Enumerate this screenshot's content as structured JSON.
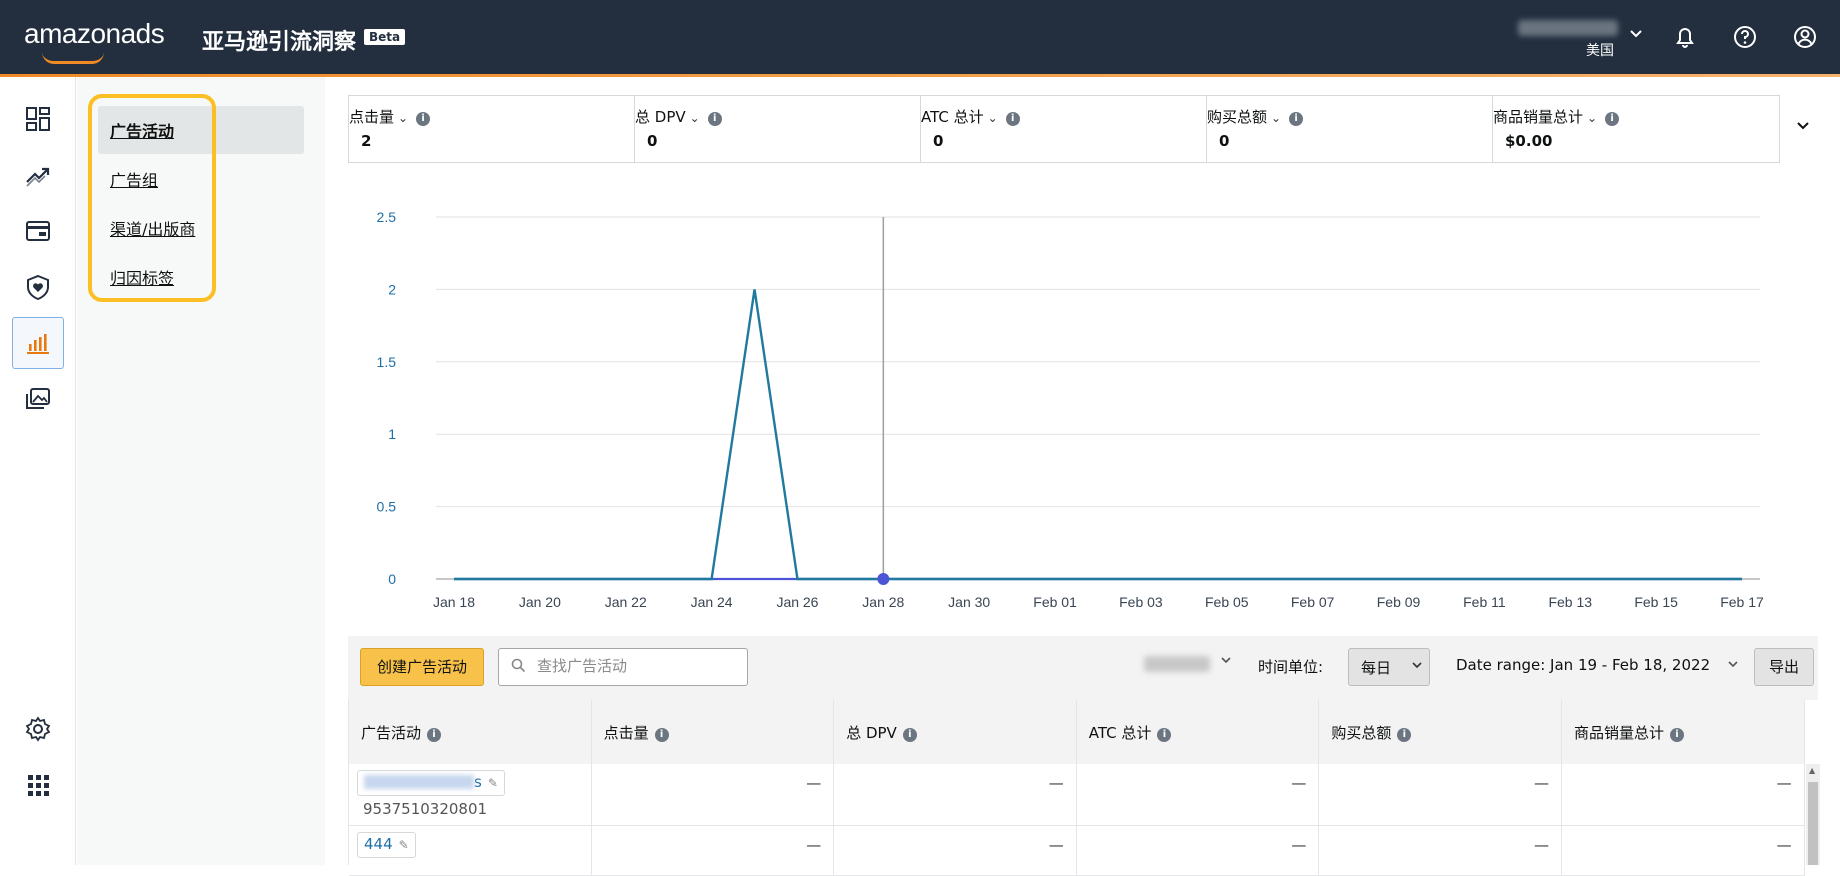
{
  "header": {
    "logo_text": "amazonads",
    "app_title": "亚马逊引流洞察",
    "beta_label": "Beta",
    "region": "美国",
    "icons": [
      "bell-icon",
      "help-icon",
      "account-icon"
    ]
  },
  "rail": {
    "items": [
      "dashboard-icon",
      "trend-icon",
      "wallet-icon",
      "shield-heart-icon",
      "bar-chart-icon",
      "media-icon"
    ],
    "bottom": [
      "settings-icon",
      "apps-grid-icon"
    ]
  },
  "subnav": {
    "items": [
      "广告活动",
      "广告组",
      "渠道/出版商",
      "归因标签"
    ]
  },
  "metrics": [
    {
      "label": "点击量",
      "value": "2"
    },
    {
      "label": "总 DPV",
      "value": "0"
    },
    {
      "label": "ATC 总计",
      "value": "0"
    },
    {
      "label": "购买总额",
      "value": "0"
    },
    {
      "label": "商品销量总计",
      "value": "$0.00"
    }
  ],
  "chart_data": {
    "type": "line",
    "x_ticks": [
      "Jan 18",
      "Jan 20",
      "Jan 22",
      "Jan 24",
      "Jan 26",
      "Jan 28",
      "Jan 30",
      "Feb 01",
      "Feb 03",
      "Feb 05",
      "Feb 07",
      "Feb 09",
      "Feb 11",
      "Feb 13",
      "Feb 15",
      "Feb 17"
    ],
    "y_ticks": [
      "2.5",
      "2",
      "1.5",
      "1",
      "0.5",
      "0"
    ],
    "ylim": [
      0,
      2.5
    ],
    "grid": true,
    "colors": {
      "primary": "#1f7a9e",
      "secondary": "#4b55d6"
    },
    "series": [
      {
        "values": [
          0,
          0,
          0,
          0,
          0,
          0,
          0,
          2,
          0,
          0,
          0,
          0,
          0,
          0,
          0,
          0,
          0,
          0,
          0,
          0,
          0,
          0,
          0,
          0,
          0,
          0,
          0,
          0,
          0,
          0,
          0
        ]
      },
      {
        "values": [
          0,
          0,
          0,
          0,
          0,
          0,
          0,
          0,
          0,
          0,
          0,
          0,
          0,
          0,
          0,
          0,
          0,
          0,
          0,
          0,
          0,
          0,
          0,
          0,
          0,
          0,
          0,
          0,
          0,
          0,
          0
        ]
      }
    ],
    "x_dates": [
      "Jan 18",
      "Jan 19",
      "Jan 20",
      "Jan 21",
      "Jan 22",
      "Jan 23",
      "Jan 24",
      "Jan 25",
      "Jan 26",
      "Jan 27",
      "Jan 28",
      "Jan 29",
      "Jan 30",
      "Jan 31",
      "Feb 01",
      "Feb 02",
      "Feb 03",
      "Feb 04",
      "Feb 05",
      "Feb 06",
      "Feb 07",
      "Feb 08",
      "Feb 09",
      "Feb 10",
      "Feb 11",
      "Feb 12",
      "Feb 13",
      "Feb 14",
      "Feb 15",
      "Feb 16",
      "Feb 17"
    ],
    "hover_date": "Jan 28"
  },
  "toolbar": {
    "create_label": "创建广告活动",
    "search_placeholder": "查找广告活动",
    "time_unit_label": "时间单位:",
    "time_unit_value": "每日",
    "date_range": "Date range: Jan 19 - Feb 18, 2022",
    "export_label": "导出"
  },
  "table": {
    "headers": [
      "广告活动",
      "点击量",
      "总 DPV",
      "ATC 总计",
      "购买总额",
      "商品销量总计"
    ],
    "rows": [
      {
        "name_suffix": "s",
        "id": "9537510320801",
        "cells": [
          "—",
          "—",
          "—",
          "—",
          "—"
        ]
      },
      {
        "name": "444",
        "cells": [
          "—",
          "—",
          "—",
          "—",
          "—"
        ]
      }
    ]
  }
}
